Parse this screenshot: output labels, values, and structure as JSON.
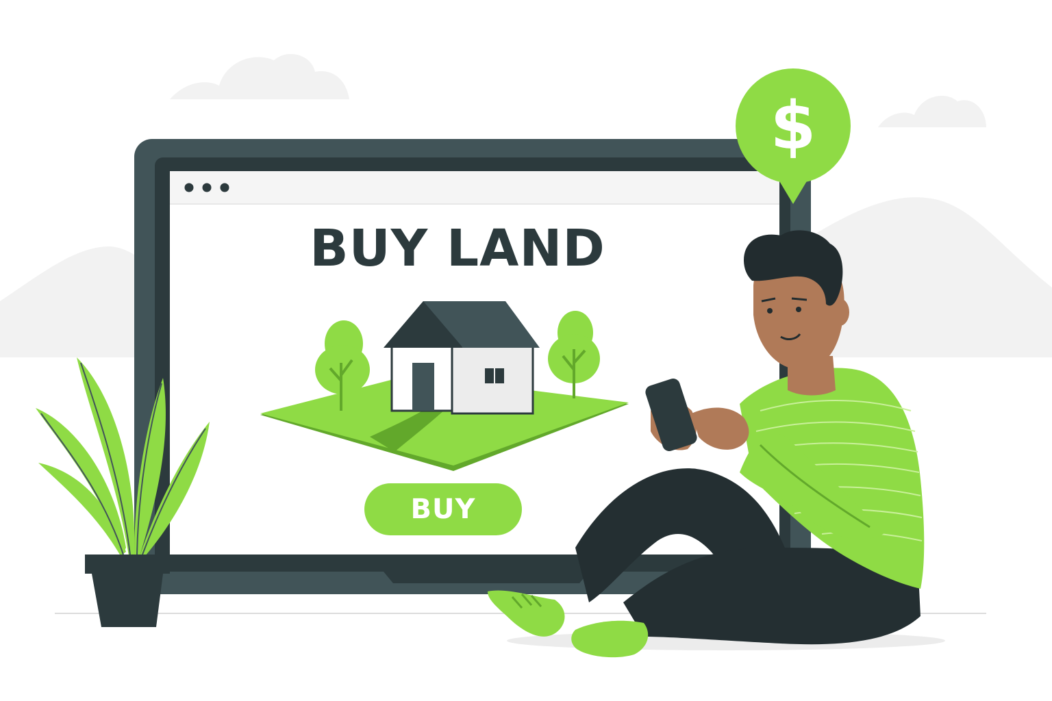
{
  "landing": {
    "headline": "BUY LAND",
    "buy_button_label": "BUY"
  },
  "price_pin": {
    "symbol": "$",
    "icon": "dollar-pin-icon"
  },
  "browser_controls": {
    "icon": "three-dots-icon"
  },
  "colors": {
    "accent_green": "#8fdb45",
    "dark_green": "#62a82b",
    "slate": "#415458",
    "slate_dark": "#2c3a3d",
    "skin": "#b07a58",
    "hair": "#222c2f",
    "pants": "#242f32",
    "background_gray": "#f2f2f2"
  }
}
